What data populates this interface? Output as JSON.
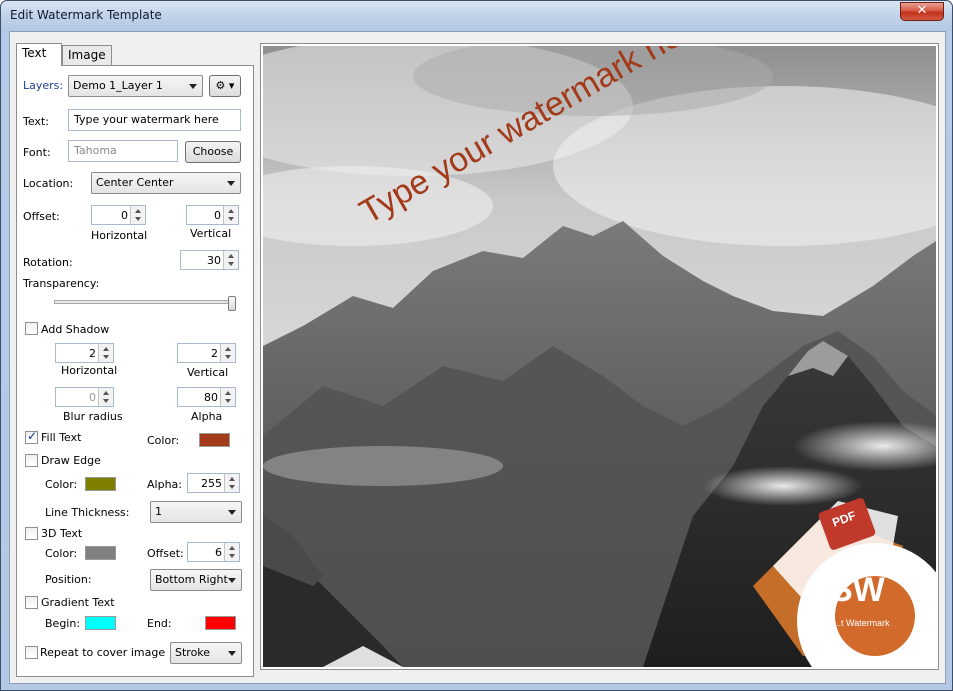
{
  "window": {
    "title": "Edit Watermark Template",
    "close_glyph": "✕"
  },
  "tabs": [
    {
      "label": "Text"
    },
    {
      "label": "Image"
    }
  ],
  "form": {
    "layers_label": "Layers:",
    "layers_value": "Demo 1_Layer 1",
    "settings_glyph": "⚙ ▾",
    "text_label": "Text:",
    "text_value": "Type your watermark here",
    "font_label": "Font:",
    "font_value": "Tahoma",
    "choose_button": "Choose",
    "location_label": "Location:",
    "location_value": "Center Center",
    "offset_label": "Offset:",
    "offset_h_value": "0",
    "offset_h_caption": "Horizontal",
    "offset_v_value": "0",
    "offset_v_caption": "Vertical",
    "rotation_label": "Rotation:",
    "rotation_value": "30",
    "transparency_label": "Transparency:",
    "transparency_level": 1.0,
    "add_shadow_label": "Add Shadow",
    "add_shadow_checked": false,
    "shadow_h_value": "2",
    "shadow_h_caption": "Horizontal",
    "shadow_v_value": "2",
    "shadow_v_caption": "Vertical",
    "blur_value": "0",
    "blur_caption": "Blur radius",
    "alpha_value": "80",
    "alpha_caption": "Alpha",
    "fill_text_label": "Fill Text",
    "fill_text_checked": true,
    "fill_color_label": "Color:",
    "fill_color": "#a33a1a",
    "draw_edge_label": "Draw Edge",
    "draw_edge_checked": false,
    "edge_color_label": "Color:",
    "edge_color": "#808000",
    "edge_alpha_label": "Alpha:",
    "edge_alpha_value": "255",
    "line_thickness_label": "Line Thickness:",
    "line_thickness_value": "1",
    "text3d_label": "3D Text",
    "text3d_checked": false,
    "text3d_color_label": "Color:",
    "text3d_color": "#808080",
    "text3d_offset_label": "Offset:",
    "text3d_offset_value": "6",
    "position_label": "Position:",
    "position_value": "Bottom Right",
    "gradient_label": "Gradient Text",
    "gradient_checked": false,
    "gradient_begin_label": "Begin:",
    "gradient_begin_color": "#00ffff",
    "gradient_end_label": "End:",
    "gradient_end_color": "#ff0000",
    "repeat_label": "Repeat to cover image",
    "repeat_checked": false,
    "repeat_mode_value": "Stroke"
  },
  "preview": {
    "watermark_text": "Type your watermark here",
    "watermark_color": "#a33a1a",
    "logo_text": "SW",
    "logo_caption": "St...t Watermark",
    "logo_pdf_text": "PDF"
  }
}
